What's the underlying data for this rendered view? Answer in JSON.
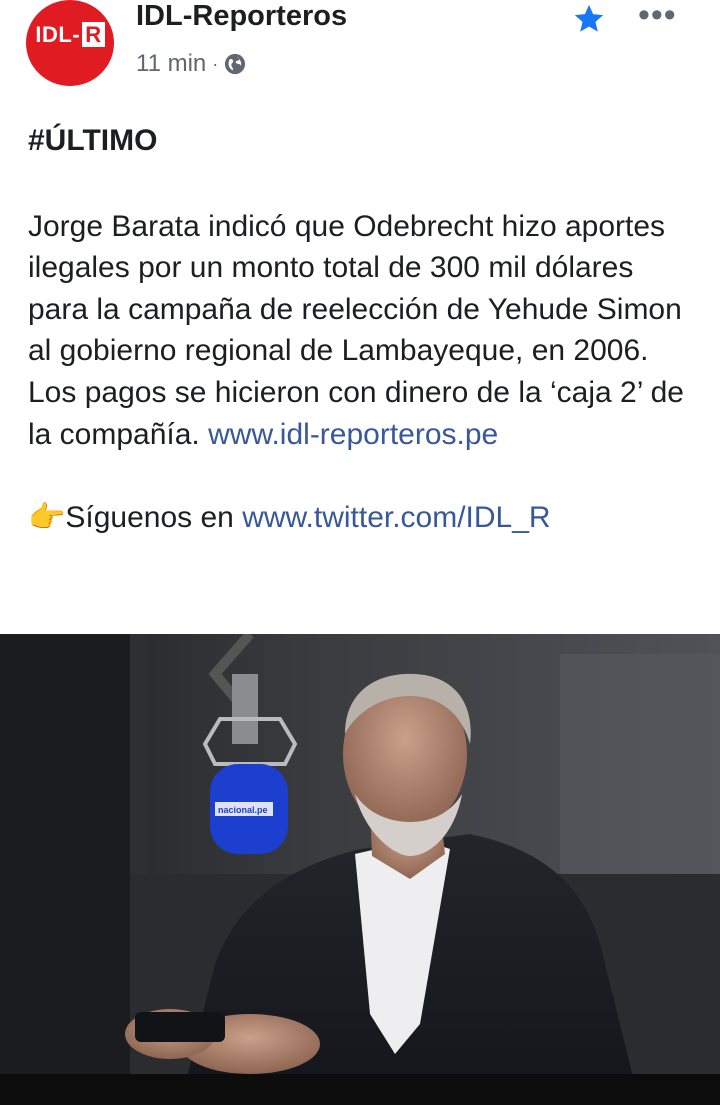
{
  "header": {
    "avatar_text": "IDL-",
    "avatar_text_r": "R",
    "page_name": "IDL-Reporteros",
    "timestamp": "11 min",
    "dot": "·",
    "privacy_icon": "globe-icon",
    "favorite_icon": "star-icon",
    "more_icon": "more-options-icon",
    "more_glyph": "•••"
  },
  "post": {
    "hashtag": "#ÚLTIMO",
    "body": "Jorge Barata indicó que Odebrecht hizo aportes ilegales por un monto total de 300 mil dólares para la campaña de reelección de Yehude Simon al gobierno regional de Lambayeque, en 2006. Los pagos se hicieron con dinero de la ‘caja 2’ de la compañía.",
    "link": "www.idl-reporteros.pe",
    "follow_emoji": "👉",
    "follow_text": "Síguenos en",
    "follow_link": "www.twitter.com/IDL_R"
  },
  "photo": {
    "mic_label": "nacional.pe"
  },
  "colors": {
    "brand_red": "#e11b22",
    "link_blue": "#385898",
    "star_blue": "#1877f2",
    "text_dark": "#1c1e21",
    "text_gray": "#606770"
  }
}
